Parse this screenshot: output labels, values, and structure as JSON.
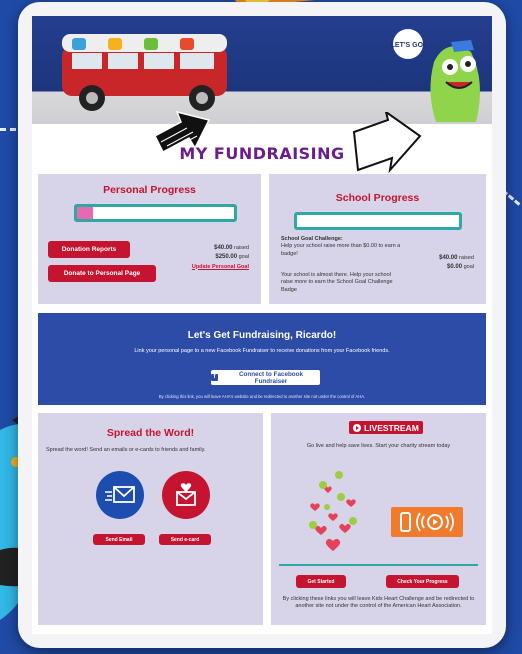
{
  "page_title": "MY FUNDRAISING",
  "hero": {
    "speech_bubble": "LET'S GO!"
  },
  "personal_progress": {
    "title": "Personal Progress",
    "progress_fraction": 0.1,
    "donation_reports_label": "Donation Reports",
    "donate_personal_label": "Donate to Personal Page",
    "raised_amount": "$40.00",
    "raised_suffix": "raised",
    "goal_amount": "$250.00",
    "goal_suffix": "goal",
    "update_goal_label": "Update Personal Goal"
  },
  "school_progress": {
    "title": "School Progress",
    "progress_fraction": 0.0,
    "challenge_heading": "School Goal Challenge:",
    "challenge_text": "Help your school raise more than $0.00 to earn a badge!",
    "raised_amount": "$40.00",
    "raised_suffix": "raised",
    "goal_amount": "$0.00",
    "goal_suffix": "goal",
    "note": "Your school is almost there. Help your school raise more to earn the School Goal Challenge Badge"
  },
  "facebook": {
    "heading": "Let's Get Fundraising, Ricardo!",
    "text": "Link your personal page to a new Facebook Fundraiser to receive donations from your Facebook friends.",
    "button_label": "Connect to Facebook Fundraiser",
    "disclaimer": "By clicking this link, you will leave AHA's website and be redirected to another site not under the control of AHA."
  },
  "spread": {
    "title": "Spread the Word!",
    "text": "Spread the word! Send an emails or e-cards to friends and family.",
    "send_email_label": "Send Email",
    "send_ecard_label": "Send e-card"
  },
  "livestream": {
    "badge_label": "LIVESTREAM",
    "text": "Go live and help save lives. Start your charity stream today",
    "get_started_label": "Get Started",
    "check_progress_label": "Check Your Progress",
    "disclaimer": "By clicking these links you will leave Kids Heart Challenge and be redirected to another site not under the control of the American Heart Association."
  },
  "colors": {
    "accent_red": "#c5142f",
    "panel_lavender": "#d7d3e8",
    "facebook_blue": "#2c4ca8",
    "progress_teal": "#2ea7a5"
  },
  "icons": [
    "fundraising-arrow-icon",
    "email-icon",
    "ecard-heart-icon",
    "facebook-icon",
    "livestream-play-icon",
    "phone-stream-icon",
    "hearts-likes-icon"
  ]
}
